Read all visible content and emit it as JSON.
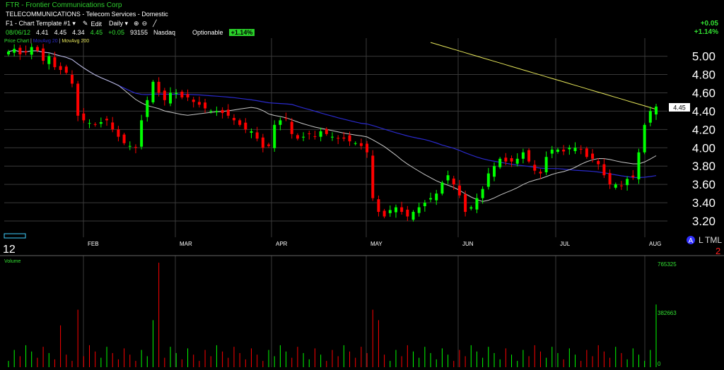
{
  "header": {
    "symbol_line": "FTR - Frontier Communications Corp",
    "sector_line": "TELECOMMUNICATIONS - Telecom Services - Domestic",
    "template": "F1 - Chart Template #1",
    "edit": "Edit",
    "period": "Daily",
    "date": "08/06/12",
    "open": "4.41",
    "high": "4.45",
    "low": "4.34",
    "close": "4.45",
    "change": "+0.05",
    "volume": "93155",
    "exchange": "Nasdaq",
    "optionable": "Optionable",
    "pct_badge": "+1.14%",
    "right_change": "+0.05",
    "right_pct": "+1.14%"
  },
  "legend": {
    "price": "Price Chart",
    "ma20": "MovAvg 20",
    "ma200": "MovAvg 200",
    "volume": "Volume"
  },
  "price_axis": {
    "ticks": [
      "5.00",
      "4.80",
      "4.60",
      "4.40",
      "4.20",
      "4.00",
      "3.80",
      "3.60",
      "3.40",
      "3.20"
    ],
    "last_label": "4.45"
  },
  "volume_axis": {
    "ticks": [
      "765325",
      "382663",
      "0"
    ]
  },
  "month_labels": [
    "FEB",
    "MAR",
    "APR",
    "MAY",
    "JUN",
    "JUL",
    "AUG"
  ],
  "misc": {
    "year_mark": "12",
    "tml": "TML",
    "a_mark": "A",
    "l_mark": "L",
    "right_mark": "2"
  },
  "colors": {
    "up": "#00ff00",
    "down": "#ff0000",
    "ma20": "#c8c8c8",
    "ma50": "#2a2acc",
    "ma200": "#e6e65a",
    "grid": "#3a3a3a"
  },
  "chart_data": {
    "type": "candlestick",
    "y_range": [
      3.1,
      5.12
    ],
    "closes": [
      5.05,
      5.08,
      5.02,
      5.04,
      5.1,
      5.06,
      4.95,
      5.0,
      4.88,
      4.85,
      4.82,
      4.7,
      4.35,
      4.3,
      4.27,
      4.25,
      4.28,
      4.3,
      4.2,
      4.12,
      4.05,
      4.02,
      4.0,
      4.3,
      4.52,
      4.72,
      4.6,
      4.52,
      4.6,
      4.6,
      4.55,
      4.55,
      4.5,
      4.47,
      4.43,
      4.4,
      4.4,
      4.38,
      4.35,
      4.3,
      4.25,
      4.2,
      4.18,
      4.1,
      4.0,
      4.02,
      4.25,
      4.3,
      4.32,
      4.15,
      4.1,
      4.12,
      4.15,
      4.12,
      4.18,
      4.15,
      4.12,
      4.1,
      4.1,
      4.07,
      4.05,
      4.02,
      3.95,
      3.45,
      3.3,
      3.25,
      3.32,
      3.35,
      3.3,
      3.25,
      3.3,
      3.35,
      3.4,
      3.45,
      3.5,
      3.62,
      3.7,
      3.6,
      3.48,
      3.3,
      3.35,
      3.45,
      3.55,
      3.72,
      3.8,
      3.88,
      3.85,
      3.85,
      3.88,
      3.95,
      3.85,
      3.75,
      3.72,
      3.9,
      3.98,
      3.98,
      3.96,
      4.0,
      4.0,
      3.98,
      3.9,
      3.88,
      3.82,
      3.7,
      3.6,
      3.6,
      3.58,
      3.66,
      3.68,
      3.95,
      4.25,
      4.4,
      4.45
    ],
    "ma20_shape": "gray smoothed average",
    "ma50_shape": "blue smoothed average",
    "ma200_segment": "yellow declining line from mid-May to Aug",
    "volume_max": 765325
  }
}
